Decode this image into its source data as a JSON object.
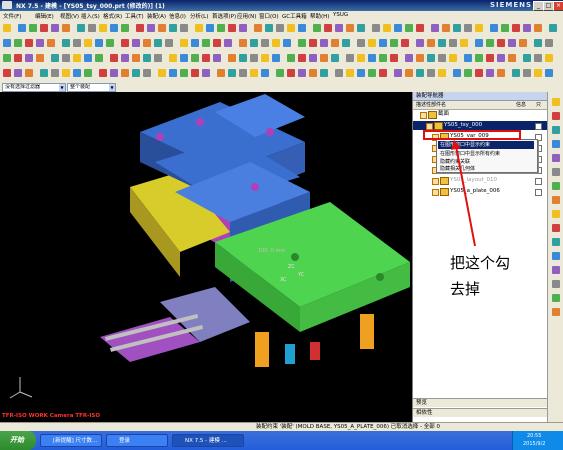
{
  "window": {
    "title": "NX 7.5 - 建模 - [YS05_tsy_000.prt (修改的)]    (1)",
    "brand": "SIEMENS",
    "buttons": [
      "_",
      "□",
      "×"
    ]
  },
  "menu": {
    "items": [
      "文件(F)",
      "编辑(E)",
      "视图(V)",
      "插入(S)",
      "格式(R)",
      "工具(T)",
      "装配(A)",
      "信息(I)",
      "分析(L)",
      "首选项(P)",
      "应用(N)",
      "窗口(O)",
      "GC工具箱",
      "帮助(H)",
      "YSUG"
    ]
  },
  "selection_bar": {
    "filter": "没有选择过滤器",
    "scope": "整个装配"
  },
  "viewport": {
    "label": "TFR-ISO WORK Camera TFR-ISO",
    "dimension_text": "100  .0 mm",
    "axis_labels": [
      "ZC",
      "YC",
      "XC"
    ]
  },
  "navigator": {
    "title": "装配导航器",
    "col_name": "描述性部件名",
    "col_info": "信息",
    "col_r": "只",
    "rows": [
      {
        "label": "截面",
        "indent": 0
      },
      {
        "label": "YS05_tsy_000",
        "indent": 1,
        "highlight": true
      },
      {
        "label": "YS05_var_009",
        "indent": 2
      },
      {
        "label": "YS05_cool_001",
        "indent": 2
      },
      {
        "label": "YS05_fill_011",
        "indent": 2
      },
      {
        "label": "YS05_misc_005",
        "indent": 2
      },
      {
        "label": "YS05_layout_010",
        "indent": 2,
        "grey": true
      },
      {
        "label": "YS05_a_plate_006",
        "indent": 2
      }
    ],
    "context_menu": [
      "在图形窗口中显示约束",
      "在图形窗口中显示所有约束",
      "隐藏约束关联",
      "隐藏相关几何体"
    ],
    "panels": [
      "预览",
      "相依性"
    ]
  },
  "annotation": {
    "line1": "把这个勾",
    "line2": "去掉",
    "color": "#000000"
  },
  "status": {
    "text": "装配约束 '装配' (MOLD BASE, YS05_A_PLATE_006) 已取消选择 - 全部 0"
  },
  "taskbar": {
    "start": "开始",
    "tasks": [
      "[新提醒] 尺寸数...",
      "登录",
      "NX 7.5 - 建模 ..."
    ],
    "time": "20:55",
    "date": "2015/9/2"
  },
  "colors": {
    "title": "#0a246a",
    "mold_blue": "#3a6fd0",
    "mold_green": "#4fd44f",
    "mold_yellow": "#d8cc2a",
    "spring_orange": "#f0a020",
    "magenta": "#c03cc0",
    "highlight": "#0a246a",
    "arrow_red": "#e01010"
  }
}
